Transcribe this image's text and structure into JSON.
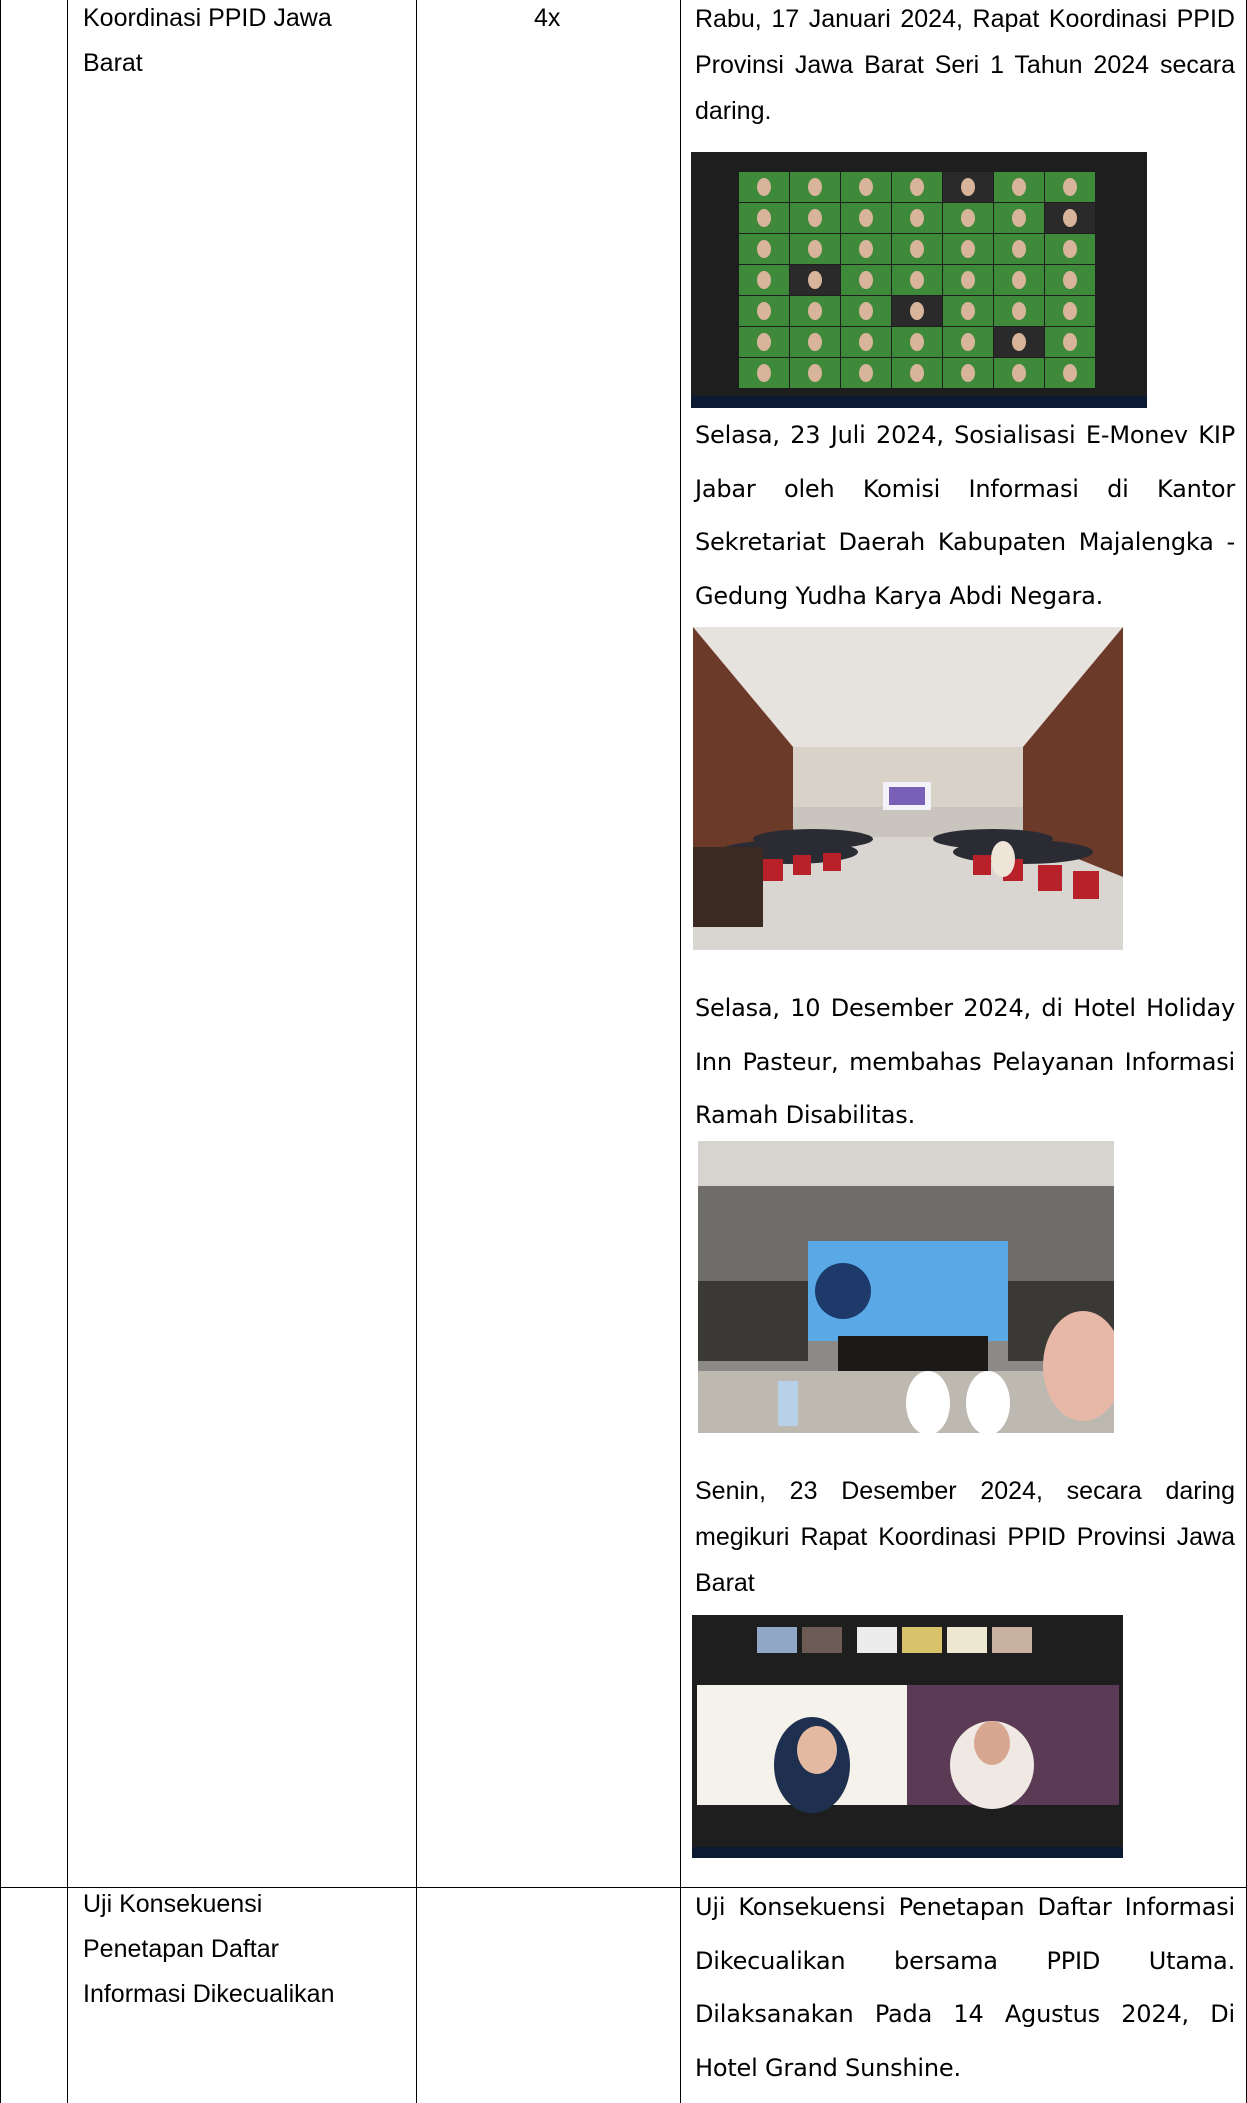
{
  "rows": [
    {
      "activity_lines": [
        "Koordinasi PPID Jawa",
        "Barat"
      ],
      "frequency": "4x",
      "entries": [
        {
          "text": "Rabu, 17 Januari 2024, Rapat Koordinasi PPID Provinsi Jawa Barat Seri 1 Tahun 2024 secara daring."
        },
        {
          "text": "Selasa, 23 Juli 2024, Sosialisasi E-Monev KIP Jabar oleh Komisi Informasi di Kantor Sekretariat Daerah Kabupaten Majalengka - Gedung Yudha Karya Abdi Negara."
        },
        {
          "text": "Selasa, 10 Desember 2024, di Hotel Holiday Inn Pasteur, membahas Pelayanan Informasi Ramah Disabilitas."
        },
        {
          "text": "Senin, 23 Desember 2024, secara daring megikuri Rapat Koordinasi PPID Provinsi Jawa Barat"
        }
      ]
    },
    {
      "activity_lines": [
        "Uji Konsekuensi",
        "Penetapan Daftar",
        "Informasi Dikecualikan"
      ],
      "frequency": "",
      "entries": [
        {
          "text": "Uji Konsekuensi Penetapan Daftar Informasi Dikecualikan bersama PPID Utama. Dilaksanakan Pada 14 Agustus 2024, Di Hotel Grand Sunshine."
        }
      ]
    }
  ],
  "colors": {
    "border": "#000000",
    "zoom_green": "#3f8a3a",
    "zoom_dark": "#1e1e1e",
    "hall_red": "#b8202a",
    "screen_blue": "#5aa9e6"
  }
}
